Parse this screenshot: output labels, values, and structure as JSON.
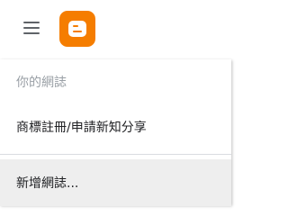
{
  "header": {
    "menu_icon": "hamburger-menu-icon",
    "logo_icon": "blogger-logo-icon",
    "brand_color": "#f57d00"
  },
  "dropdown": {
    "section_label": "你的網誌",
    "blogs": [
      {
        "label": "商標註冊/申請新知分享"
      }
    ],
    "new_blog_label": "新增網誌..."
  }
}
